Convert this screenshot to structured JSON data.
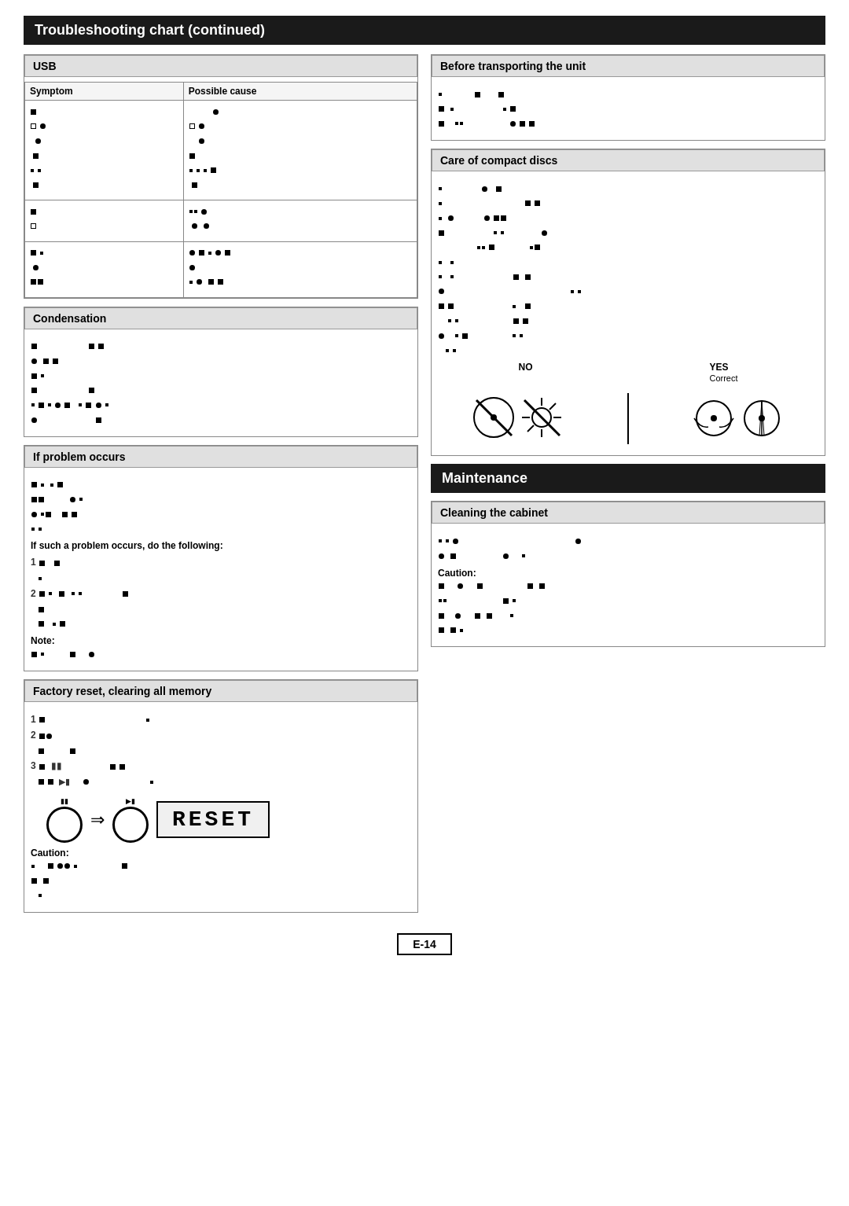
{
  "page": {
    "title": "Troubleshooting chart (continued)",
    "page_number": "E-14"
  },
  "usb": {
    "header": "USB",
    "col1": "Symptom",
    "col2": "Possible cause"
  },
  "condensation": {
    "header": "Condensation"
  },
  "if_problem": {
    "header": "If problem occurs",
    "bold_text": "If such a problem occurs, do the following:",
    "note_label": "Note:",
    "items": [
      "1",
      "2"
    ]
  },
  "factory": {
    "header": "Factory reset, clearing all memory",
    "caution_label": "Caution:",
    "items": [
      "1",
      "2",
      "3"
    ]
  },
  "transport": {
    "header": "Before transporting the unit"
  },
  "care": {
    "header": "Care of compact discs",
    "no_label": "NO",
    "yes_label": "YES",
    "correct_label": "Correct"
  },
  "maintenance": {
    "header": "Maintenance"
  },
  "cleaning": {
    "header": "Cleaning the cabinet",
    "caution_label": "Caution:"
  }
}
